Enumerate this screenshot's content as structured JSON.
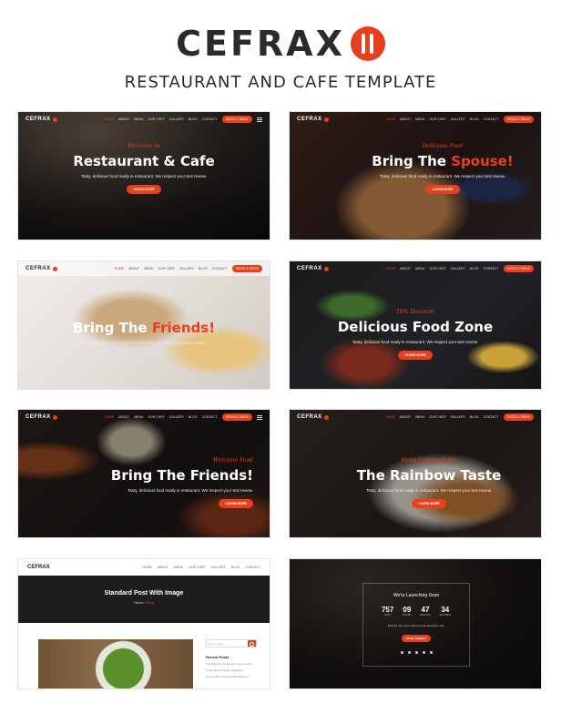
{
  "brand": {
    "name": "CEFRAX",
    "subtitle": "RESTAURANT AND CAFE TEMPLATE",
    "accent": "#e8401c"
  },
  "nav": {
    "logo": "CEFRAX",
    "items": [
      "HOME",
      "ABOUT",
      "MENU",
      "OUR CHEF",
      "GALLERY",
      "BLOG",
      "CONTACT"
    ],
    "book": "BOOK A TABLE"
  },
  "cards": [
    {
      "kicker": "Welcome to",
      "title_a": "Restaurant & Cafe",
      "title_b": "",
      "desc": "Tasty, delicious food ready in restaurant. We respect your test review.",
      "cta": "LEARN MORE"
    },
    {
      "kicker": "Delicious Food",
      "title_a": "Bring The ",
      "title_b": "Spouse!",
      "desc": "Tasty, delicious food ready in restaurant. We respect your test review.",
      "cta": "LEARN MORE"
    },
    {
      "kicker": "",
      "title_a": "Bring The ",
      "title_b": "Friends!",
      "desc": "Tasty, delicious food ready in restaurant. We respect your test review.",
      "cta": ""
    },
    {
      "kicker": "50% Discount",
      "title_a": "Delicious Food Zone",
      "title_b": "",
      "desc": "Tasty, delicious food ready in restaurant. We respect your test review.",
      "cta": "LEARN MORE"
    },
    {
      "kicker": "Welcome Food",
      "title_a": "Bring The Friends!",
      "title_b": "",
      "desc": "Tasty, delicious food ready in restaurant. We respect your test review.",
      "cta": "LEARN MORE"
    },
    {
      "kicker": "Make Unforgettable",
      "title_a": "The Rainbow Taste",
      "title_b": "",
      "desc": "Tasty, delicious food ready in restaurant. We respect your test review.",
      "cta": "LEARN MORE"
    }
  ],
  "blog": {
    "title": "Standard Post With Image",
    "crumb_home": "Home",
    "crumb_sep": " / ",
    "crumb_current": "Blog",
    "search_placeholder": "Search Here...",
    "recent": "Recent Posts",
    "posts": [
      "The Best and Trending in your country",
      "Good Tips for better restaurant",
      "How to start a Restaurant Business"
    ]
  },
  "soon": {
    "title": "We're Launching Soon",
    "count": [
      {
        "n": "757",
        "l": "Days"
      },
      {
        "n": "09",
        "l": "Hours"
      },
      {
        "n": "47",
        "l": "Minutes"
      },
      {
        "n": "34",
        "l": "Seconds"
      }
    ],
    "note": "We'll be here soon with our new awesome site.",
    "cta": "SEND A QUERY"
  }
}
